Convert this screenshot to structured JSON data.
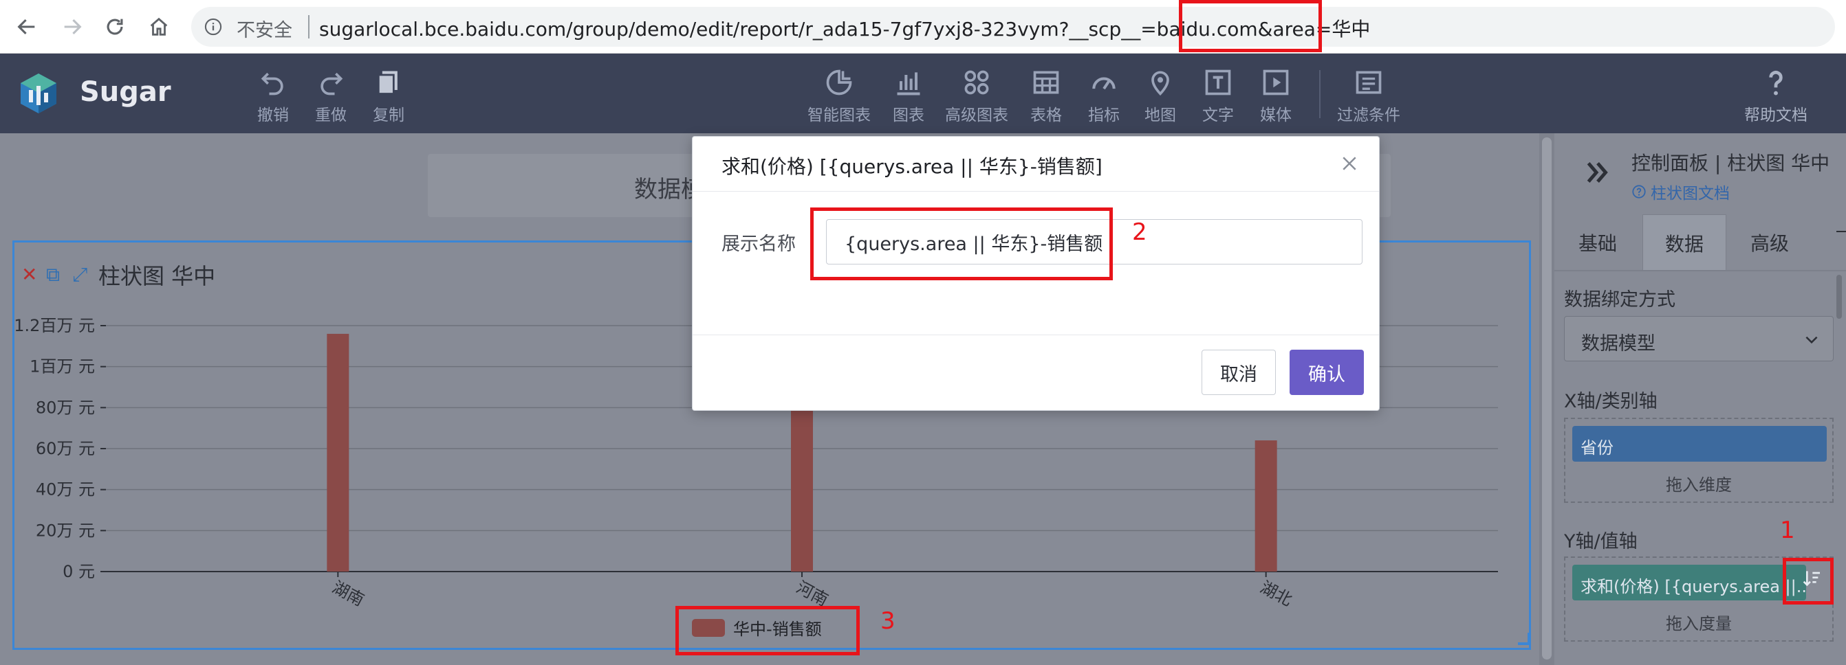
{
  "browser": {
    "security_label": "不安全",
    "url": "sugarlocal.bce.baidu.com/group/demo/edit/report/r_ada15-7gf7yxj8-323vym?__scp__=baidu.com&area=华中"
  },
  "app": {
    "name": "Sugar",
    "toolbar_left": [
      {
        "label": "撤销",
        "icon": "undo-icon"
      },
      {
        "label": "重做",
        "icon": "redo-icon"
      },
      {
        "label": "复制",
        "icon": "copy-icon"
      }
    ],
    "toolbar_center": [
      {
        "label": "智能图表",
        "icon": "smart-chart-icon"
      },
      {
        "label": "图表",
        "icon": "bar-chart-icon"
      },
      {
        "label": "高级图表",
        "icon": "advanced-chart-icon"
      },
      {
        "label": "表格",
        "icon": "table-icon"
      },
      {
        "label": "指标",
        "icon": "gauge-icon"
      },
      {
        "label": "地图",
        "icon": "map-pin-icon"
      },
      {
        "label": "文字",
        "icon": "text-icon"
      },
      {
        "label": "媒体",
        "icon": "media-icon"
      },
      {
        "label": "过滤条件",
        "icon": "filter-icon"
      }
    ],
    "help_label": "帮助文档"
  },
  "canvas": {
    "title_text": "数据模"
  },
  "chart": {
    "name": "柱状图 华中",
    "legend_label": "华中-销售额",
    "bar_color": "#8a4a48"
  },
  "chart_data": {
    "type": "bar",
    "title": "柱状图 华中",
    "categories": [
      "湖南",
      "河南",
      "湖北"
    ],
    "series": [
      {
        "name": "华中-销售额",
        "values": [
          1160000,
          1000000,
          640000
        ]
      }
    ],
    "y_tick_labels": [
      "0 元",
      "20万 元",
      "40万 元",
      "60万 元",
      "80万 元",
      "1百万 元",
      "1.2百万 元"
    ],
    "ylim": [
      0,
      1200000
    ],
    "grid": true,
    "legend": "bottom-center"
  },
  "side_panel": {
    "title": "控制面板 | 柱状图 华中",
    "doc_link": "柱状图文档",
    "tabs": [
      "基础",
      "数据",
      "高级"
    ],
    "active_tab": "数据",
    "binding_label": "数据绑定方式",
    "binding_value": "数据模型",
    "x_axis_label": "X轴/类别轴",
    "x_field": "省份",
    "x_drop_hint": "拖入维度",
    "y_axis_label": "Y轴/值轴",
    "y_field": "求和(价格) [{querys.area ||...",
    "y_drop_hint": "拖入度量"
  },
  "modal": {
    "title": "求和(价格) [{querys.area || 华东}-销售额]",
    "field_label": "展示名称",
    "input_value": "{querys.area || 华东}-销售额",
    "cancel_label": "取消",
    "confirm_label": "确认"
  },
  "annotations": [
    "1",
    "2",
    "3"
  ],
  "colors": {
    "header_bg": "#3b4257",
    "accent": "#6a5cc7",
    "annotation": "#e8141a",
    "selection": "#3b86d6"
  }
}
